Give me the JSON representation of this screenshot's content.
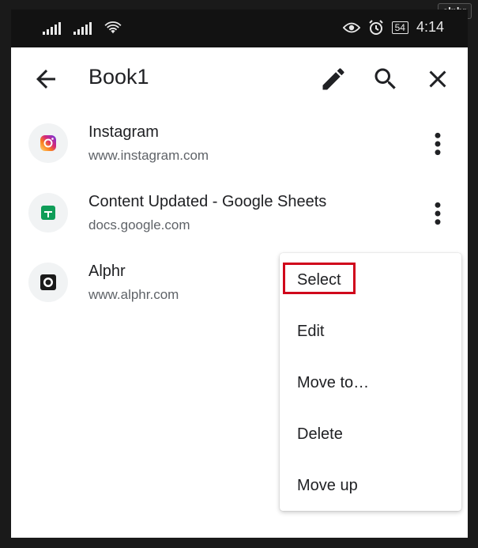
{
  "watermark": "alphr",
  "status_bar": {
    "battery": "54",
    "time": "4:14"
  },
  "app_bar": {
    "title": "Book1"
  },
  "bookmarks": [
    {
      "title": "Instagram",
      "url": "www.instagram.com",
      "icon": "instagram-icon"
    },
    {
      "title": "Content Updated - Google Sheets",
      "url": "docs.google.com",
      "icon": "google-sheets-icon"
    },
    {
      "title": "Alphr",
      "url": "www.alphr.com",
      "icon": "alphr-icon"
    }
  ],
  "context_menu": {
    "items": [
      "Select",
      "Edit",
      "Move to…",
      "Delete",
      "Move up"
    ],
    "highlighted": "Select",
    "highlight_color": "#d0021b"
  },
  "colors": {
    "status_bar": "#121212",
    "text_primary": "#202124",
    "text_secondary": "#5f6368",
    "icon_bg": "#f1f3f4"
  }
}
